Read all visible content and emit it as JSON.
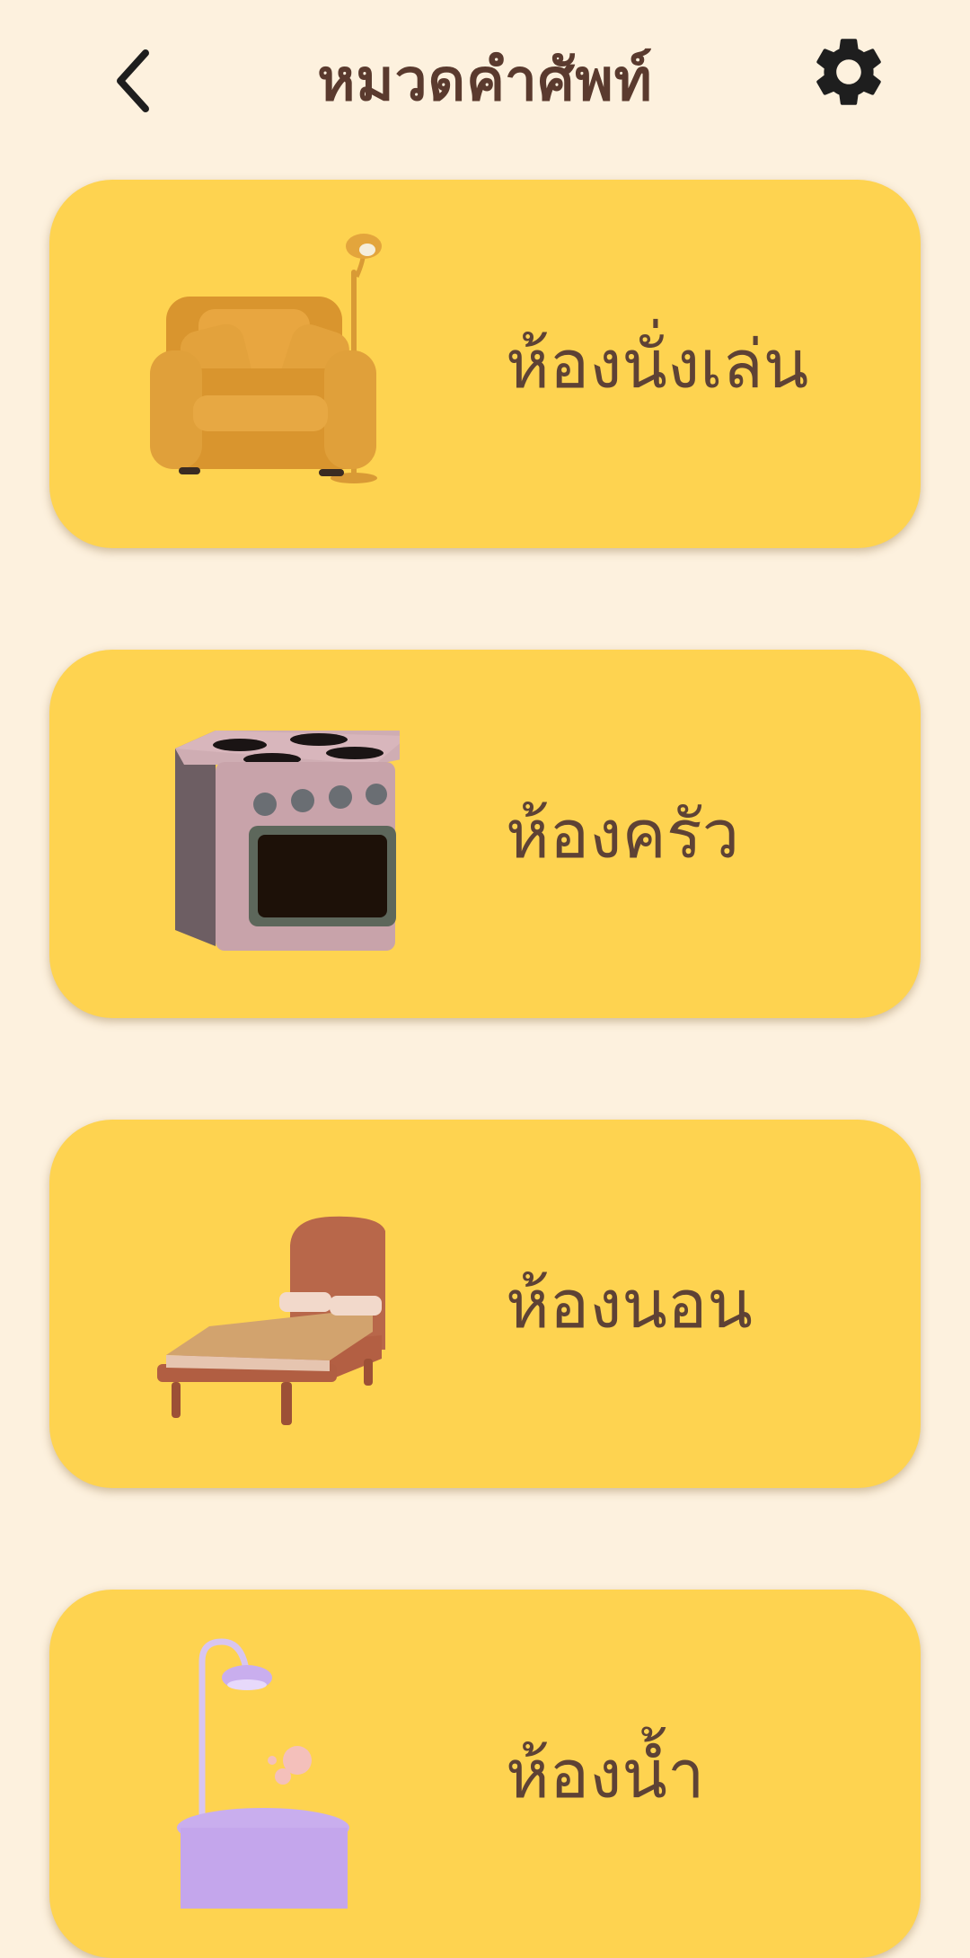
{
  "header": {
    "title": "หมวดคำศัพท์",
    "back_icon": "chevron-left-icon",
    "settings_icon": "gear-icon"
  },
  "categories": [
    {
      "label": "ห้องนั่งเล่น",
      "icon": "armchair-lamp-icon"
    },
    {
      "label": "ห้องครัว",
      "icon": "stove-oven-icon"
    },
    {
      "label": "ห้องนอน",
      "icon": "bed-icon"
    },
    {
      "label": "ห้องน้ำ",
      "icon": "bathtub-shower-icon"
    }
  ],
  "colors": {
    "background": "#FDF1DE",
    "card": "#FED350",
    "title_text": "#5A3A2E",
    "label_text": "#5E4235",
    "icon": "#1E1E1E"
  }
}
